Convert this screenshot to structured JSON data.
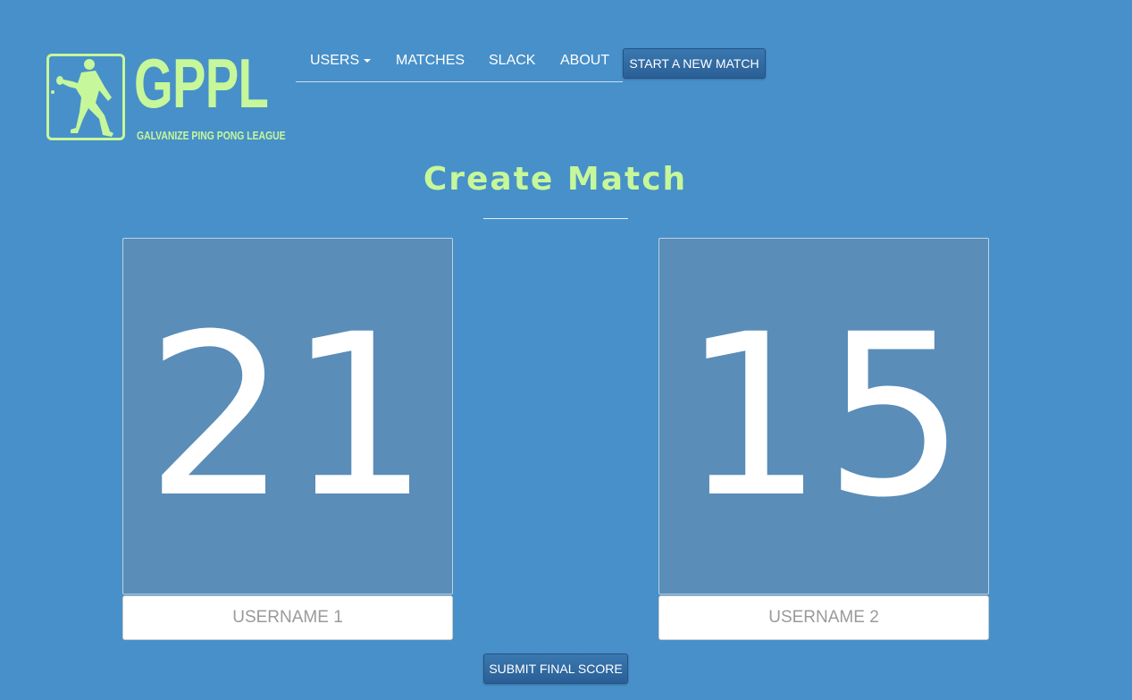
{
  "brand": {
    "title": "GPPL",
    "subtitle": "GALVANIZE PING PONG LEAGUE",
    "color": "#c6f79a",
    "icon": "ping-pong-player-icon"
  },
  "nav": {
    "users_label": "USERS",
    "matches_label": "MATCHES",
    "slack_label": "SLACK",
    "about_label": "ABOUT",
    "new_match_label": "START A NEW MATCH"
  },
  "page": {
    "title": "Create Match"
  },
  "scores": {
    "player1": "21",
    "player2": "15"
  },
  "inputs": {
    "username1_placeholder": "USERNAME 1",
    "username2_placeholder": "USERNAME 2",
    "username1_value": "",
    "username2_value": ""
  },
  "actions": {
    "submit_label": "SUBMIT FINAL SCORE"
  },
  "colors": {
    "background": "#4890c9",
    "panel": "#5a8db8",
    "button": "#2f679e",
    "accent": "#c6f79a"
  }
}
